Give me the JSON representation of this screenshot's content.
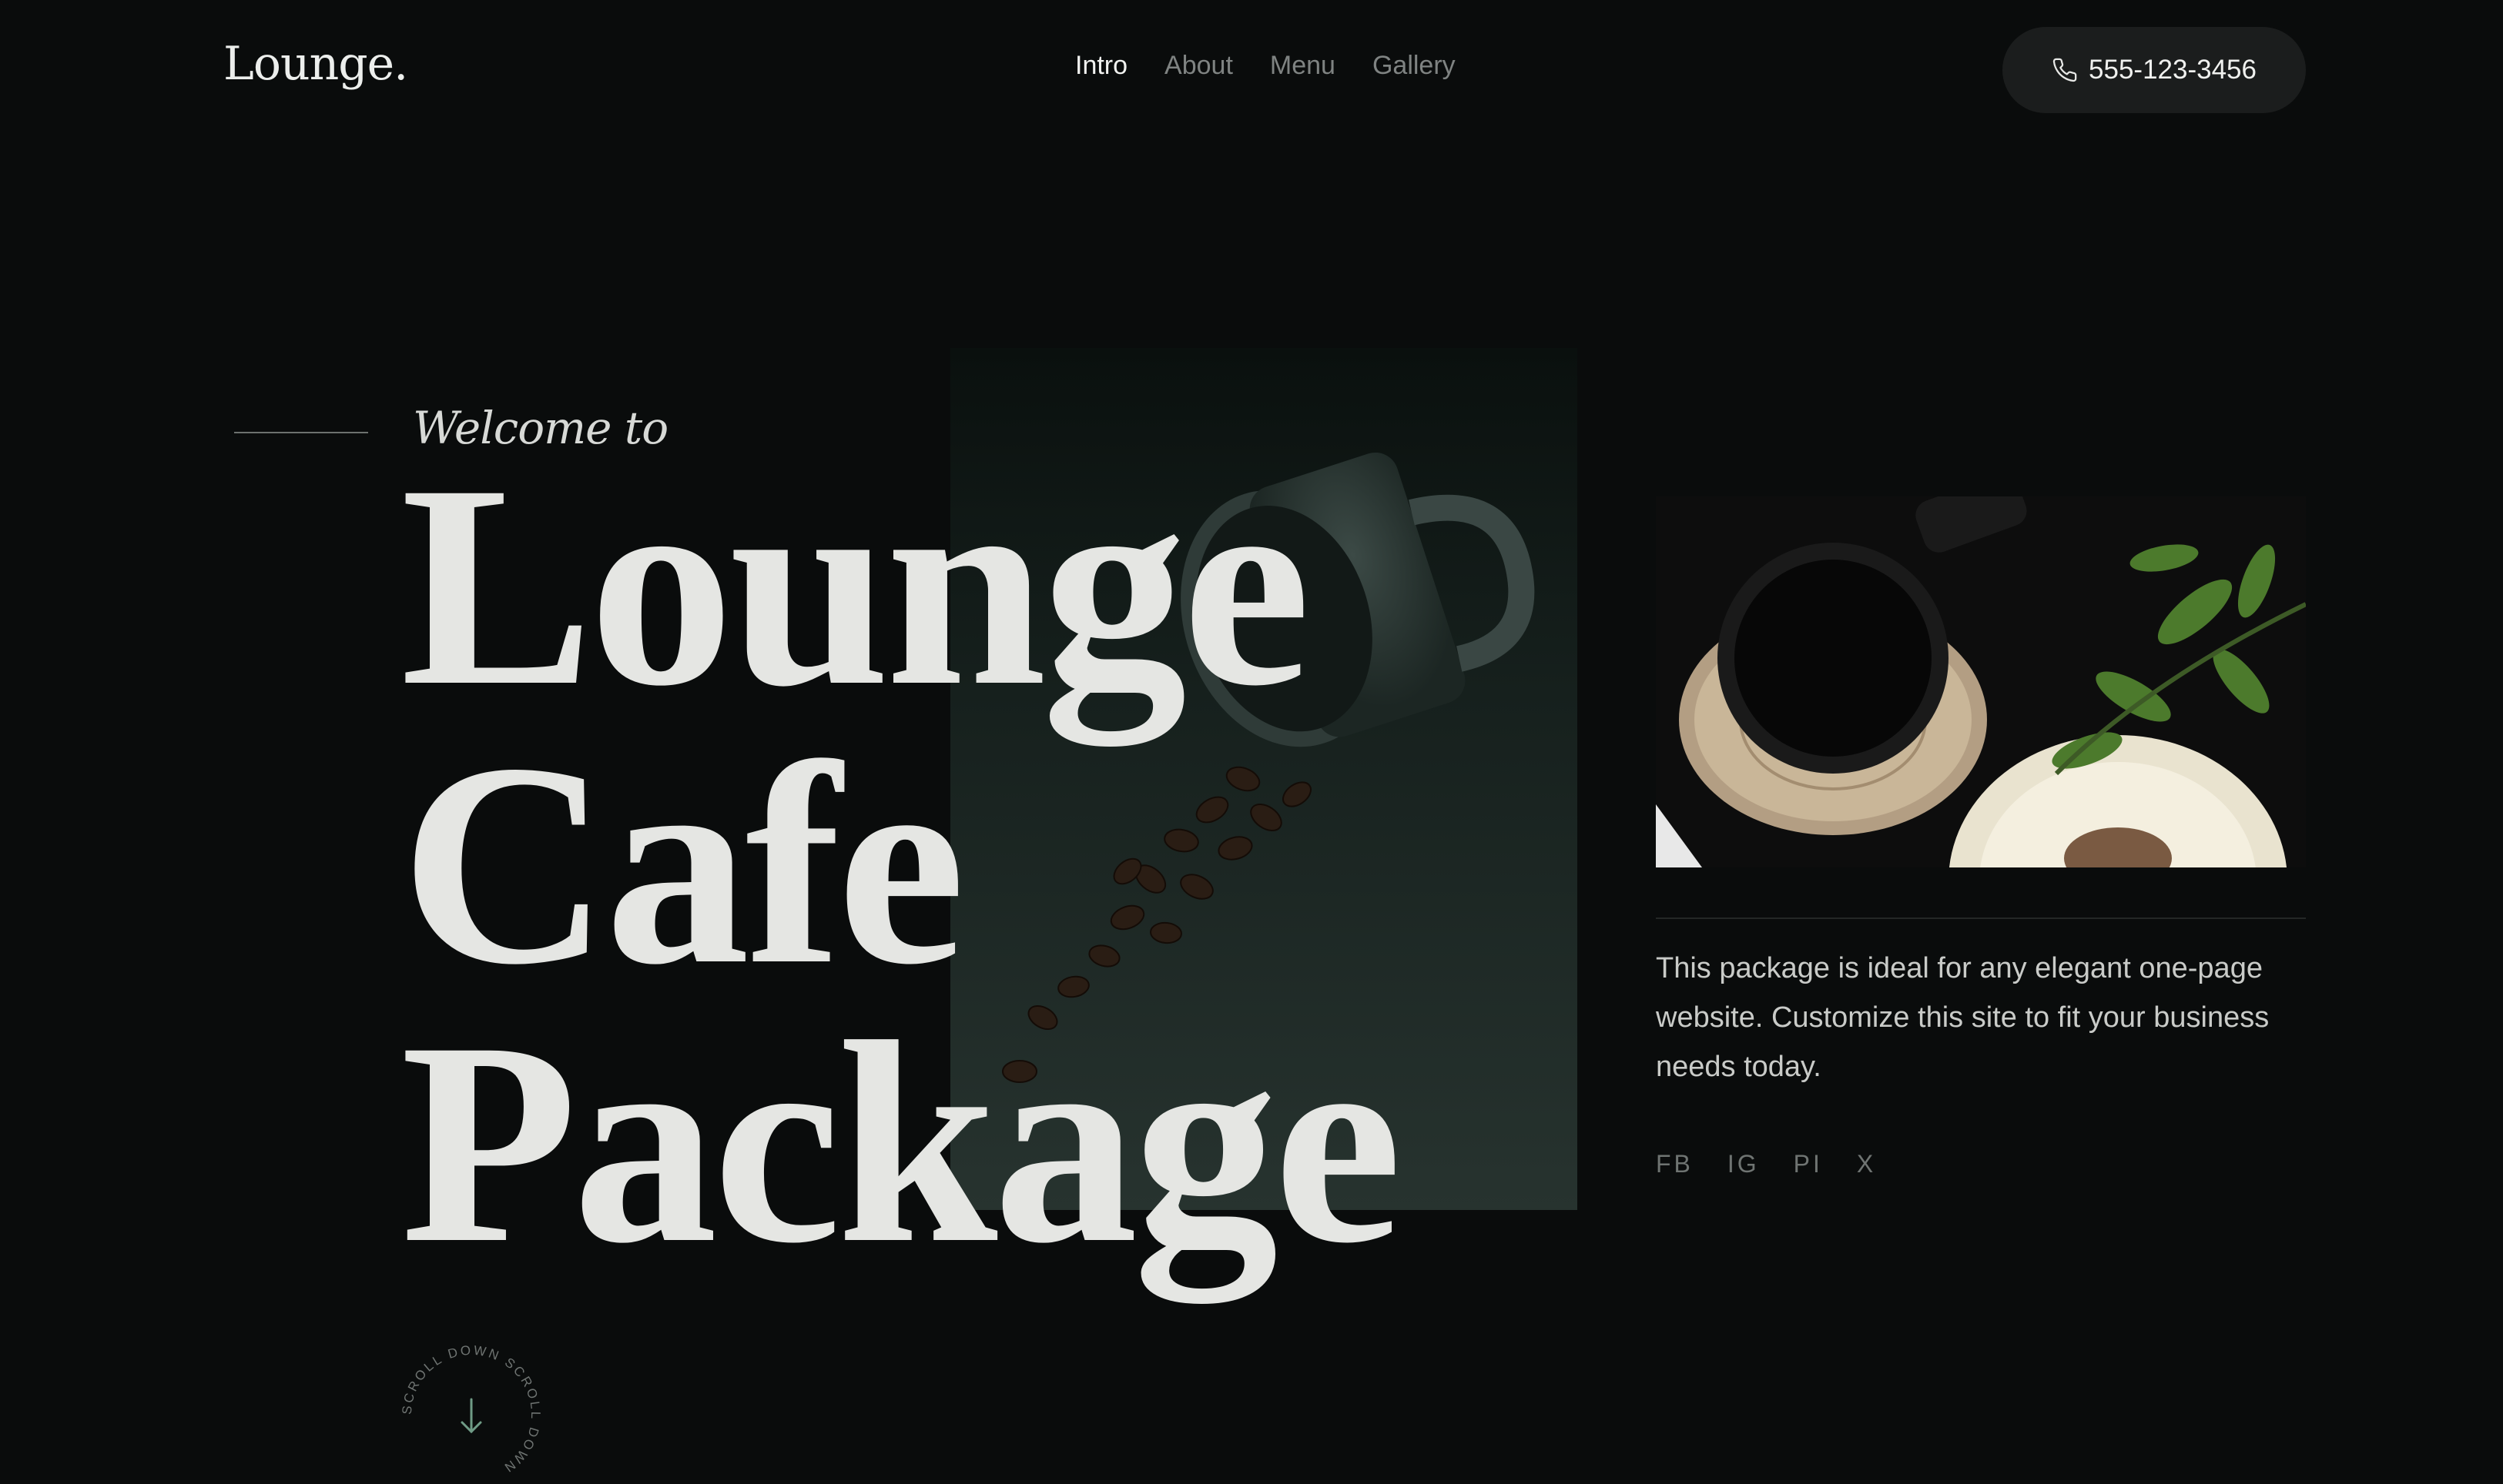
{
  "header": {
    "logo": "Lounge.",
    "nav": [
      {
        "label": "Intro",
        "active": true
      },
      {
        "label": "About",
        "active": false
      },
      {
        "label": "Menu",
        "active": false
      },
      {
        "label": "Gallery",
        "active": false
      }
    ],
    "phone": {
      "icon": "phone-icon",
      "label": "555-123-3456"
    }
  },
  "hero": {
    "eyebrow": "Welcome to",
    "title_lines": [
      "Lounge",
      "Cafe",
      "Package"
    ],
    "image_alt": "coffee-mug-spilled-beans",
    "scroll_badge": {
      "text": "SCROLL DOWN SCROLL DOWN",
      "icon": "arrow-down-icon"
    }
  },
  "side": {
    "image_alt": "coffee-cup-on-wood-slice-with-plant",
    "description": "This package is ideal for any elegant one-page website. Customize this site to fit your business needs today.",
    "social": [
      "FB",
      "IG",
      "PI",
      "X"
    ]
  },
  "colors": {
    "background": "#0a0c0c",
    "text": "#e6e7e5",
    "muted": "#7f8382",
    "accent": "#6f9b86",
    "button_bg": "#1b1d1d"
  }
}
